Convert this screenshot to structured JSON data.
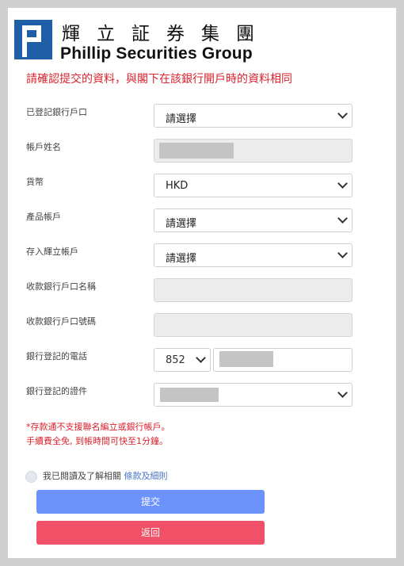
{
  "header": {
    "logo_chinese": "輝立証券集團",
    "logo_english": "Phillip Securities Group",
    "brand_color": "#1f5fa8"
  },
  "notice": "請確認提交的資料，與閣下在該銀行開戶時的資料相同",
  "form": {
    "registered_bank_account": {
      "label": "已登記銀行戶口",
      "value": "請選擇"
    },
    "account_name": {
      "label": "帳戶姓名"
    },
    "currency": {
      "label": "貨幣",
      "value": "HKD"
    },
    "product_account": {
      "label": "產品帳戶",
      "value": "請選擇"
    },
    "deposit_account": {
      "label": "存入輝立帳戶",
      "value": "請選擇"
    },
    "payee_bank_account_name": {
      "label": "收款銀行戶口名稱"
    },
    "payee_bank_account_number": {
      "label": "收款銀行戶口號碼"
    },
    "registered_phone": {
      "label": "銀行登記的電話",
      "country_code": "852"
    },
    "registered_id": {
      "label": "銀行登記的證件"
    }
  },
  "notes": {
    "line1": "*存款通不支援聯名編立或銀行帳戶。",
    "line2": "手續費全免, 到帳時間可快至1分鐘。"
  },
  "agreement": {
    "text": "我已閱讀及了解相關",
    "link": "條款及細則"
  },
  "buttons": {
    "submit": "提交",
    "back": "返回"
  },
  "colors": {
    "notice_red": "#d9232d",
    "submit_blue": "#6b93fb",
    "back_red": "#f05166",
    "link_blue": "#4a74c9"
  }
}
